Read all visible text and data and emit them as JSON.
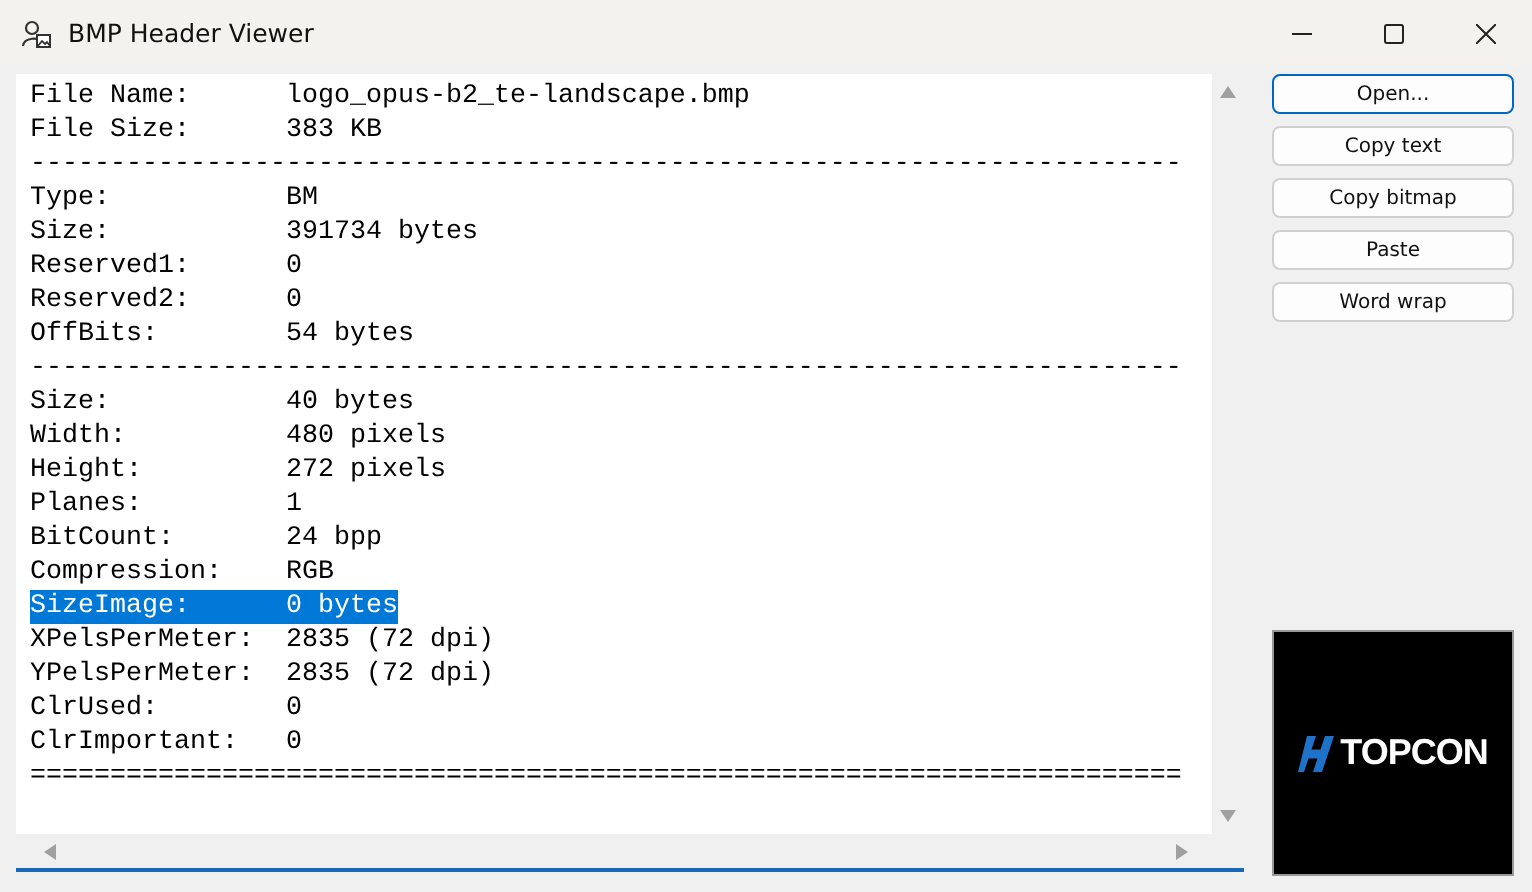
{
  "window": {
    "title": "BMP Header Viewer"
  },
  "lines": [
    {
      "kind": "field",
      "label": "File Name:",
      "value": "logo_opus-b2_te-landscape.bmp",
      "selected": false
    },
    {
      "kind": "field",
      "label": "File Size:",
      "value": "383 KB",
      "selected": false
    },
    {
      "kind": "rule",
      "text": "------------------------------------------------------------------------"
    },
    {
      "kind": "field",
      "label": "Type:",
      "value": "BM",
      "selected": false
    },
    {
      "kind": "field",
      "label": "Size:",
      "value": "391734 bytes",
      "selected": false
    },
    {
      "kind": "field",
      "label": "Reserved1:",
      "value": "0",
      "selected": false
    },
    {
      "kind": "field",
      "label": "Reserved2:",
      "value": "0",
      "selected": false
    },
    {
      "kind": "field",
      "label": "OffBits:",
      "value": "54 bytes",
      "selected": false
    },
    {
      "kind": "rule",
      "text": "------------------------------------------------------------------------"
    },
    {
      "kind": "field",
      "label": "Size:",
      "value": "40 bytes",
      "selected": false
    },
    {
      "kind": "field",
      "label": "Width:",
      "value": "480 pixels",
      "selected": false
    },
    {
      "kind": "field",
      "label": "Height:",
      "value": "272 pixels",
      "selected": false
    },
    {
      "kind": "field",
      "label": "Planes:",
      "value": "1",
      "selected": false
    },
    {
      "kind": "field",
      "label": "BitCount:",
      "value": "24 bpp",
      "selected": false
    },
    {
      "kind": "field",
      "label": "Compression:",
      "value": "RGB",
      "selected": false
    },
    {
      "kind": "field",
      "label": "SizeImage:",
      "value": "0 bytes",
      "selected": true
    },
    {
      "kind": "field",
      "label": "XPelsPerMeter:",
      "value": "2835 (72 dpi)",
      "selected": false
    },
    {
      "kind": "field",
      "label": "YPelsPerMeter:",
      "value": "2835 (72 dpi)",
      "selected": false
    },
    {
      "kind": "field",
      "label": "ClrUsed:",
      "value": "0",
      "selected": false
    },
    {
      "kind": "field",
      "label": "ClrImportant:",
      "value": "0",
      "selected": false
    },
    {
      "kind": "rule",
      "text": "========================================================================"
    }
  ],
  "buttons": [
    {
      "label": "Open...",
      "default": true
    },
    {
      "label": "Copy text",
      "default": false
    },
    {
      "label": "Copy bitmap",
      "default": false
    },
    {
      "label": "Paste",
      "default": false
    },
    {
      "label": "Word wrap",
      "default": false
    }
  ],
  "preview": {
    "logo_text": "TOPCON"
  }
}
